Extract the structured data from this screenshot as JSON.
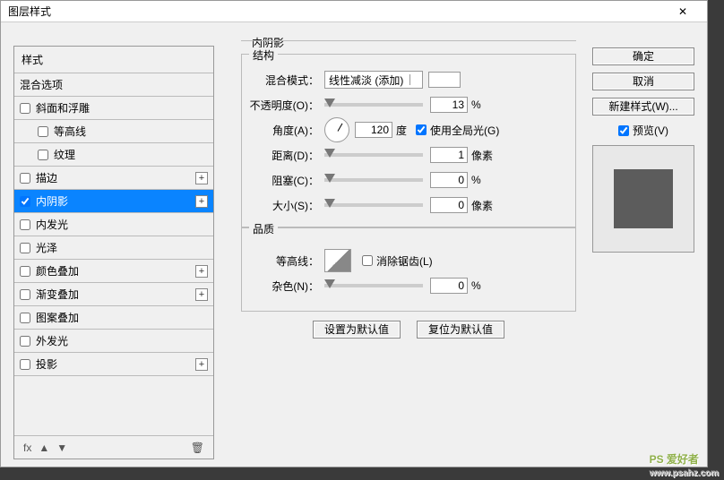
{
  "title": "图层样式",
  "styles_header": "样式",
  "blend_options": "混合选项",
  "rows": {
    "bevel": "斜面和浮雕",
    "contour": "等高线",
    "texture": "纹理",
    "stroke": "描边",
    "inner_shadow": "内阴影",
    "inner_glow": "内发光",
    "satin": "光泽",
    "color_overlay": "颜色叠加",
    "gradient_overlay": "渐变叠加",
    "pattern_overlay": "图案叠加",
    "outer_glow": "外发光",
    "drop_shadow": "投影"
  },
  "effect": {
    "title": "内阴影",
    "structure": "结构",
    "blend_mode_label": "混合模式：",
    "blend_mode_value": "线性减淡 (添加)",
    "opacity_label": "不透明度(O)：",
    "opacity_value": "13",
    "angle_label": "角度(A)：",
    "angle_value": "120",
    "angle_unit": "度",
    "use_global": "使用全局光(G)",
    "distance_label": "距离(D)：",
    "distance_value": "1",
    "px": "像素",
    "choke_label": "阻塞(C)：",
    "choke_value": "0",
    "pct": "%",
    "size_label": "大小(S)：",
    "size_value": "0",
    "quality": "品质",
    "contour_label": "等高线：",
    "antialias": "消除锯齿(L)",
    "noise_label": "杂色(N)：",
    "noise_value": "0",
    "make_default": "设置为默认值",
    "reset_default": "复位为默认值"
  },
  "buttons": {
    "ok": "确定",
    "cancel": "取消",
    "new_style": "新建样式(W)...",
    "preview": "预览(V)"
  },
  "fx": "fx",
  "watermark": {
    "brand": "PS 爱好者",
    "url": "www.psahz.com"
  }
}
